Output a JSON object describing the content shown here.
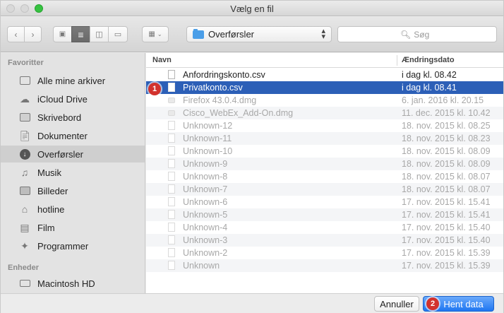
{
  "window": {
    "title": "Vælg en fil"
  },
  "toolbar": {
    "location": "Overførsler",
    "search_placeholder": "Søg"
  },
  "sidebar": {
    "favorites_header": "Favoritter",
    "devices_header": "Enheder",
    "favorites": [
      {
        "label": "Alle mine arkiver",
        "icon": "all-files-icon"
      },
      {
        "label": "iCloud Drive",
        "icon": "cloud-icon"
      },
      {
        "label": "Skrivebord",
        "icon": "desktop-icon"
      },
      {
        "label": "Dokumenter",
        "icon": "documents-icon"
      },
      {
        "label": "Overførsler",
        "icon": "downloads-icon",
        "selected": true
      },
      {
        "label": "Musik",
        "icon": "music-icon"
      },
      {
        "label": "Billeder",
        "icon": "camera-icon"
      },
      {
        "label": "hotline",
        "icon": "home-icon"
      },
      {
        "label": "Film",
        "icon": "film-icon"
      },
      {
        "label": "Programmer",
        "icon": "applications-icon"
      }
    ],
    "devices": [
      {
        "label": "Macintosh HD",
        "icon": "hard-drive-icon"
      }
    ]
  },
  "list": {
    "col_name": "Navn",
    "col_date": "Ændringsdato",
    "rows": [
      {
        "name": "Anfordringskonto.csv",
        "date": "i dag kl. 08.42"
      },
      {
        "name": "Privatkonto.csv",
        "date": "i dag kl. 08.41"
      },
      {
        "name": "Firefox 43.0.4.dmg",
        "date": "6. jan. 2016 kl. 20.15"
      },
      {
        "name": "Cisco_WebEx_Add-On.dmg",
        "date": "11. dec. 2015 kl. 10.42"
      },
      {
        "name": "Unknown-12",
        "date": "18. nov. 2015 kl. 08.25"
      },
      {
        "name": "Unknown-11",
        "date": "18. nov. 2015 kl. 08.23"
      },
      {
        "name": "Unknown-10",
        "date": "18. nov. 2015 kl. 08.09"
      },
      {
        "name": "Unknown-9",
        "date": "18. nov. 2015 kl. 08.09"
      },
      {
        "name": "Unknown-8",
        "date": "18. nov. 2015 kl. 08.07"
      },
      {
        "name": "Unknown-7",
        "date": "18. nov. 2015 kl. 08.07"
      },
      {
        "name": "Unknown-6",
        "date": "17. nov. 2015 kl. 15.41"
      },
      {
        "name": "Unknown-5",
        "date": "17. nov. 2015 kl. 15.41"
      },
      {
        "name": "Unknown-4",
        "date": "17. nov. 2015 kl. 15.40"
      },
      {
        "name": "Unknown-3",
        "date": "17. nov. 2015 kl. 15.40"
      },
      {
        "name": "Unknown-2",
        "date": "17. nov. 2015 kl. 15.39"
      },
      {
        "name": "Unknown",
        "date": "17. nov. 2015 kl. 15.39"
      }
    ]
  },
  "markers": {
    "step1": "1",
    "step2": "2"
  },
  "buttons": {
    "cancel": "Annuller",
    "confirm": "Hent data"
  },
  "colors": {
    "selection": "#2c5fb7",
    "primary_button": "#1f76f1",
    "marker": "#d2322d",
    "zoom_light": "#36c241"
  }
}
